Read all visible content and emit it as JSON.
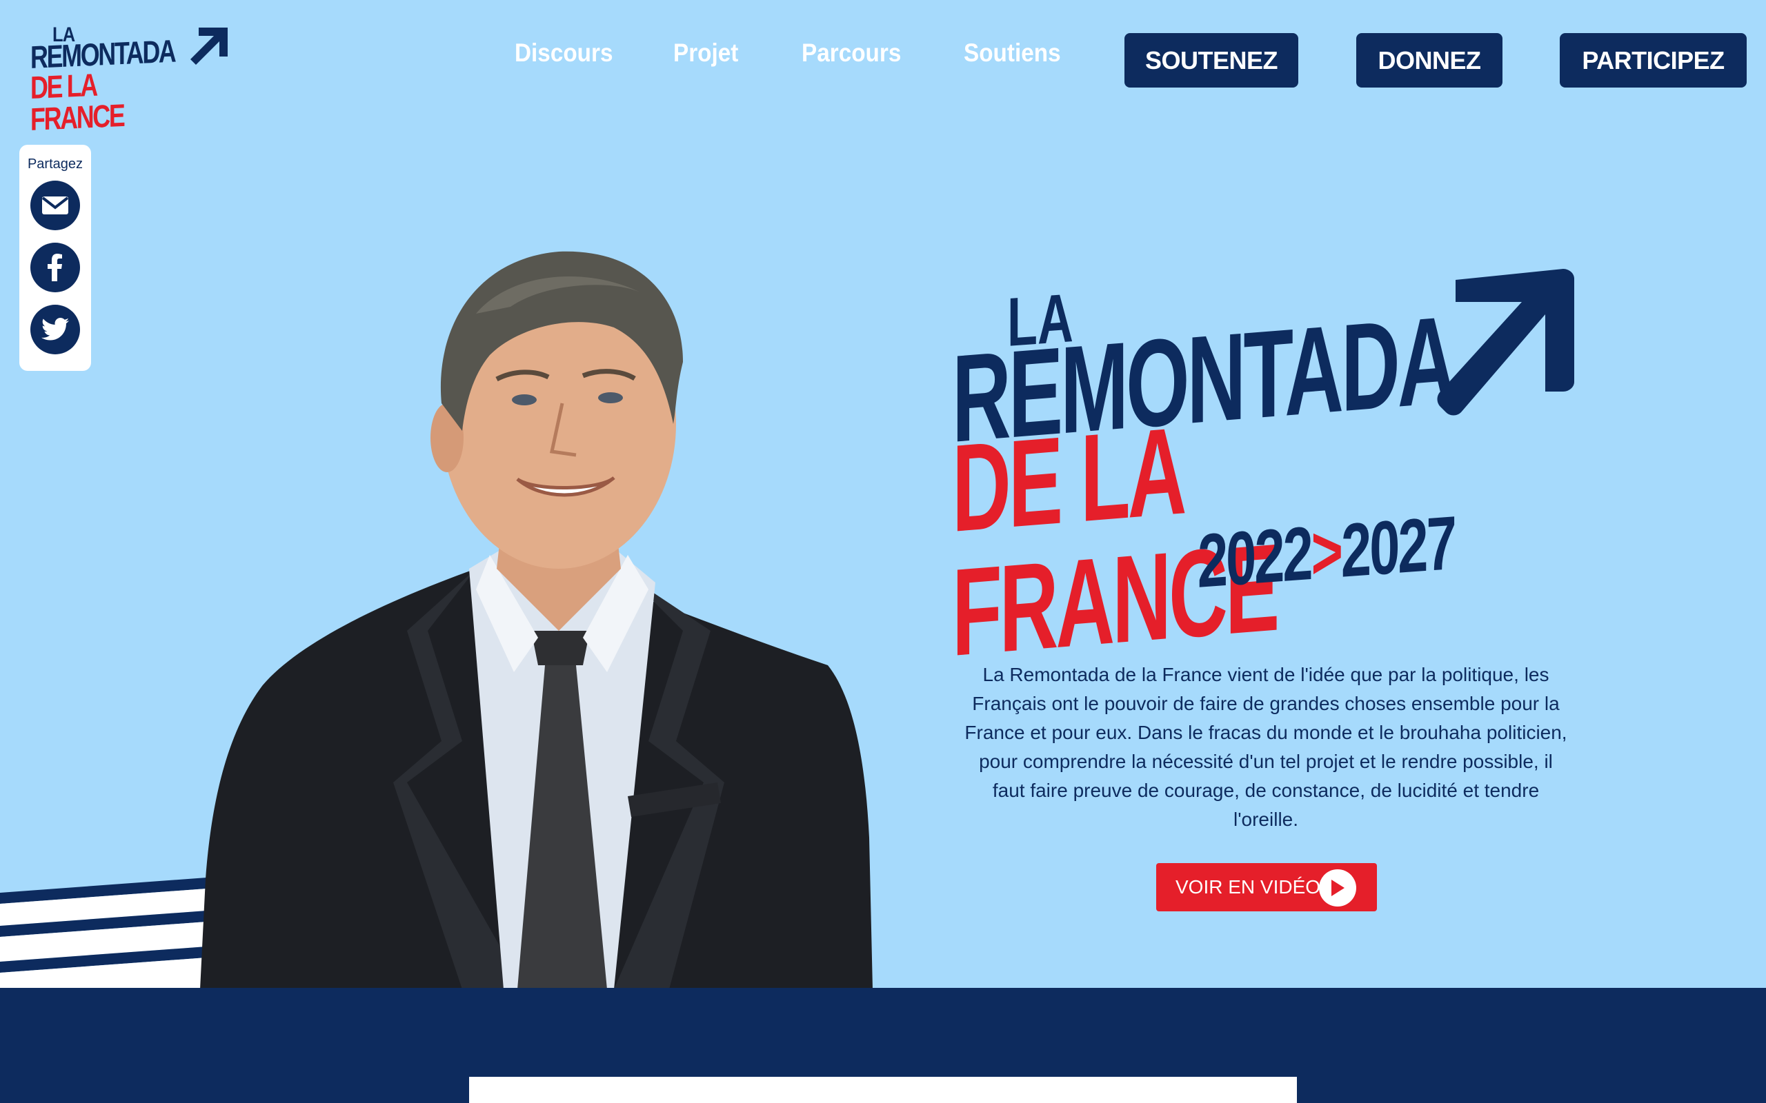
{
  "logo": {
    "line1": "LA",
    "line2": "REMONTADA",
    "line3": "DE LA FRANCE"
  },
  "nav": {
    "links": [
      "Discours",
      "Projet",
      "Parcours",
      "Soutiens"
    ],
    "buttons": [
      "SOUTENEZ",
      "DONNEZ",
      "PARTICIPEZ"
    ]
  },
  "share": {
    "label": "Partagez",
    "icons": [
      "mail-icon",
      "facebook-icon",
      "twitter-icon"
    ]
  },
  "hero": {
    "title_line1": "LA",
    "title_line2": "REMONTADA",
    "title_line3": "DE LA FRANCE",
    "year_start": "2022",
    "year_sep": ">",
    "year_end": "2027",
    "description": "La Remontada de la France vient de l'idée que par la politique, les Français ont le pouvoir de faire de grandes choses ensemble pour la France et pour eux. Dans le fracas du monde et le brouhaha politicien, pour comprendre la nécessité d'un tel projet et le rendre possible, il faut faire preuve de courage, de constance, de lucidité et tendre l'oreille.",
    "video_button": "VOIR EN VIDÉO"
  },
  "colors": {
    "navy": "#0d2b5e",
    "red": "#e51f2a",
    "sky": "#a6dafc"
  }
}
